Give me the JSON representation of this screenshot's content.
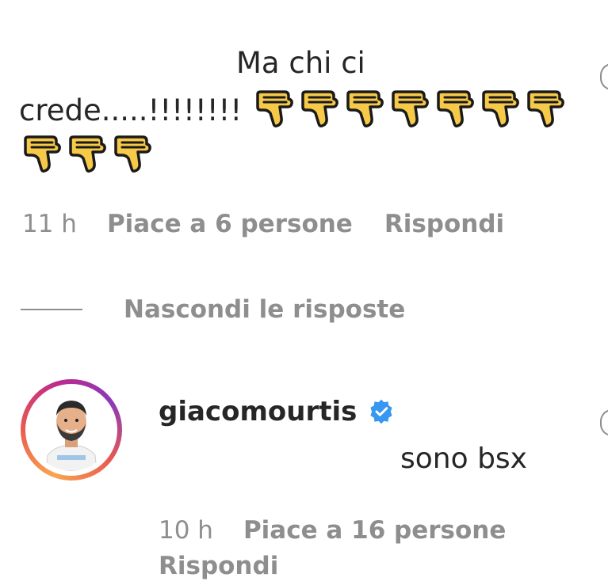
{
  "comment": {
    "line1": "Ma chi ci",
    "line2": "crede.....!!!!!!!!",
    "thumbs_icon": "thumbs-down-emoji",
    "thumbs_count_row1": 7,
    "thumbs_count_row2": 3,
    "time": "11 h",
    "likes": "Piace a 6 persone",
    "reply": "Rispondi"
  },
  "replies_toggle": {
    "label": "Nascondi le risposte"
  },
  "reply": {
    "username": "giacomourtis",
    "verified_icon": "verified-badge-icon",
    "text": "sono bsx",
    "time": "10 h",
    "likes": "Piace a 16 persone",
    "reply": "Rispondi"
  },
  "colors": {
    "text": "#262626",
    "muted": "#8e8e8e",
    "verified": "#3897f0",
    "emoji": "#f7c948"
  }
}
